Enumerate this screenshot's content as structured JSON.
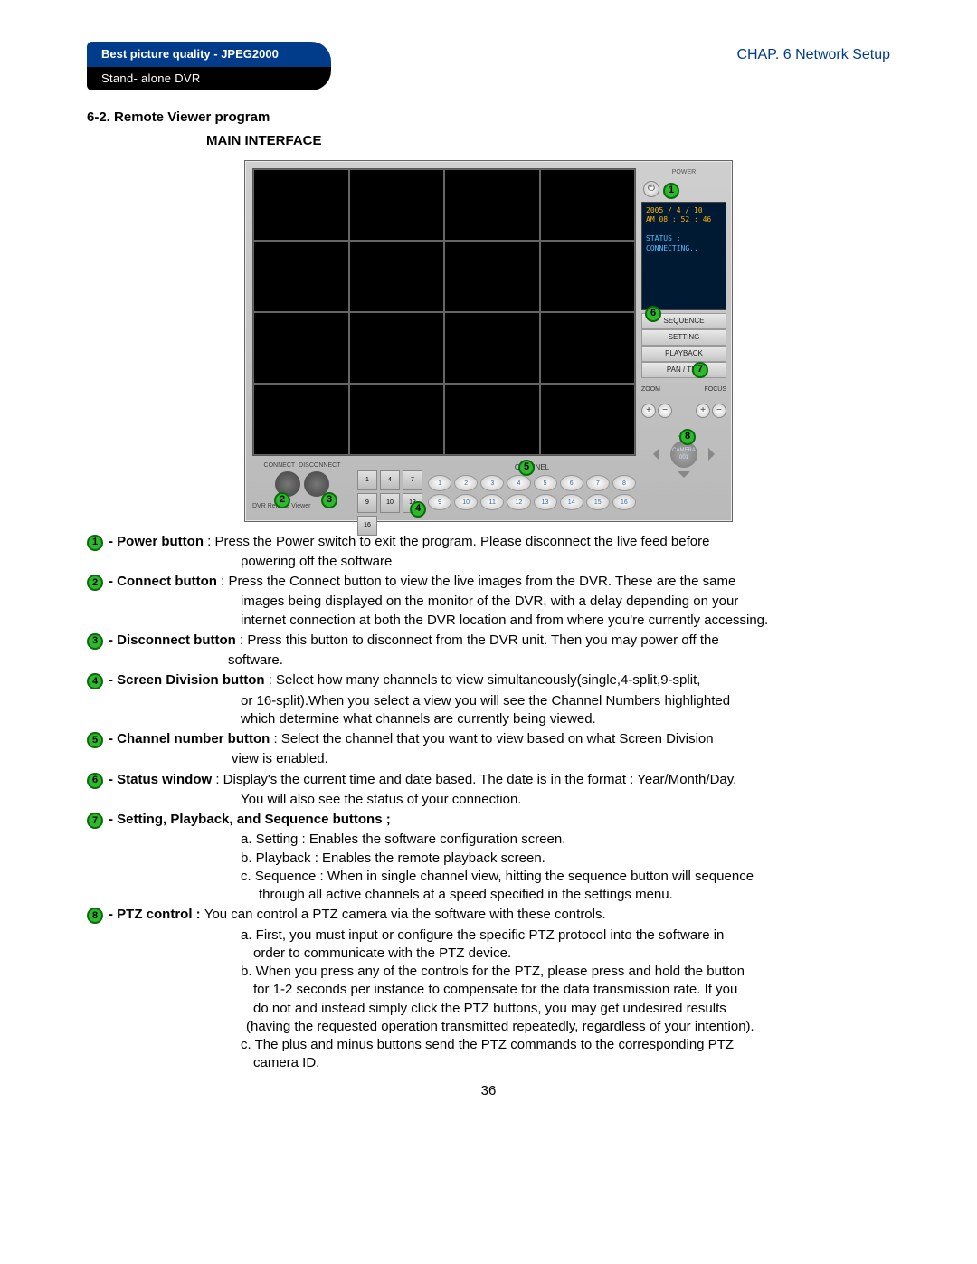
{
  "header": {
    "title_line1": "Best picture quality - JPEG2000",
    "title_line2": "Stand- alone DVR",
    "chapter": "CHAP. 6   Network Setup"
  },
  "section_heading": "6-2. Remote Viewer program",
  "sub_heading": "MAIN INTERFACE",
  "viewer": {
    "power_label": "POWER",
    "status_date": "2005 / 4 / 10",
    "status_time": "AM 08 : 52 : 46",
    "status_label": "STATUS :",
    "status_value": "CONNECTING..",
    "side_buttons": [
      "SEQUENCE",
      "SETTING",
      "PLAYBACK",
      "PAN / TILT"
    ],
    "zoom_label": "ZOOM",
    "focus_label": "FOCUS",
    "camera_label": "CAMERA",
    "camera_id": "001",
    "connect_label": "CONNECT",
    "disconnect_label": "DISCONNECT",
    "footer_brand": "DVR  Remote  Viewer",
    "division_buttons": [
      "1",
      "4",
      "7",
      "9",
      "10",
      "13",
      "16"
    ],
    "channel_label": "CHANNEL",
    "channels": [
      "1",
      "2",
      "3",
      "4",
      "5",
      "6",
      "7",
      "8",
      "9",
      "10",
      "11",
      "12",
      "13",
      "14",
      "15",
      "16"
    ]
  },
  "callouts": {
    "c1": "1",
    "c2": "2",
    "c3": "3",
    "c4": "4",
    "c5": "5",
    "c6": "6",
    "c7": "7",
    "c8": "8"
  },
  "desc": {
    "d1": {
      "term": "- Power button",
      "first": " : Press the Power switch to exit the program. Please disconnect the live feed before",
      "cont1": "powering off the software"
    },
    "d2": {
      "term": "- Connect button",
      "first": " : Press the Connect button to view the live images from the DVR. These are the same",
      "cont1": "images being displayed on the monitor of the DVR, with a delay depending on your",
      "cont2": "internet connection at both the DVR location and from where you're currently accessing."
    },
    "d3": {
      "term": "- Disconnect button",
      "first": " : Press this button to disconnect from the DVR unit. Then you may power off the",
      "cont1": "software."
    },
    "d4": {
      "term": "- Screen Division button",
      "first": " : Select how many channels to view simultaneously(single,4-split,9-split,",
      "cont1": "or 16-split).When you select a view you will see the Channel Numbers highlighted",
      "cont2": "which determine what channels are currently being viewed."
    },
    "d5": {
      "term": "- Channel number button",
      "first": " : Select the channel that you want to view based on what Screen Division",
      "cont1": "view is enabled."
    },
    "d6": {
      "term": "- Status window",
      "first": " : Display's the current time and date based. The date is in the format : Year/Month/Day.",
      "cont1": "You will also see the status of your connection."
    },
    "d7": {
      "term": "- Setting, Playback, and Sequence buttons ;",
      "a": "a. Setting : Enables the software configuration screen.",
      "b": "b. Playback : Enables the remote playback screen.",
      "c": "c. Sequence : When in single channel view, hitting the sequence button will sequence",
      "c2": "through all active channels at a speed specified in the settings menu."
    },
    "d8": {
      "term": "- PTZ control : ",
      "first": "You can control a PTZ camera via the software with these controls.",
      "a1": "a. First, you must input or configure the specific PTZ protocol into the software in",
      "a2": "order to communicate with the PTZ device.",
      "b1": "b. When you press any of the controls for the PTZ, please press and hold the button",
      "b2": "for 1-2 seconds per instance to compensate for the data transmission rate. If you",
      "b3": "do not and instead simply click the PTZ buttons, you may get undesired results",
      "b4": "(having the requested operation transmitted repeatedly, regardless of your intention).",
      "c1": "c. The plus and minus buttons send the PTZ commands to the corresponding PTZ",
      "c2": "camera ID."
    }
  },
  "page_number": "36"
}
